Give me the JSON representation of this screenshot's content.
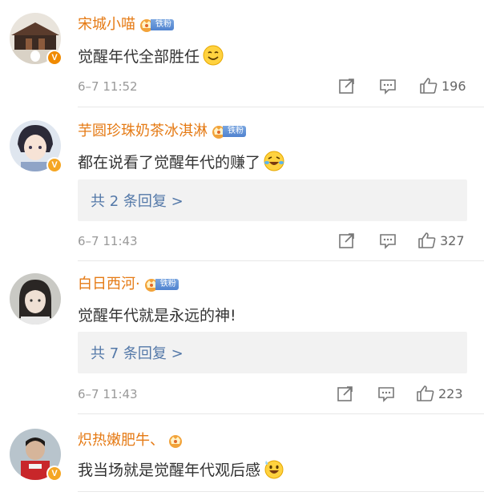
{
  "colors": {
    "username": "#e57a14",
    "reply_link": "#5378a8",
    "timestamp": "#999999",
    "verified_orange": "#f08a00",
    "verified_gold": "#f5a623",
    "fan_tag": "#5b8bd6"
  },
  "comments": [
    {
      "username": "宋城小喵",
      "fan_badge": "铁粉",
      "verified": "V",
      "verified_color": "orange",
      "text": "觉醒年代全部胜任",
      "emoji": "smile-emoji",
      "replies": null,
      "timestamp": "6–7 11:52",
      "likes": "196"
    },
    {
      "username": "芋圆珍珠奶茶冰淇淋",
      "fan_badge": "铁粉",
      "verified": "V",
      "verified_color": "gold",
      "text": "都在说看了觉醒年代的赚了",
      "emoji": "laugh-cry-emoji",
      "replies": "共 2 条回复 >",
      "timestamp": "6–7 11:43",
      "likes": "327"
    },
    {
      "username": "白日西河·",
      "fan_badge": "铁粉",
      "verified": "",
      "text": "觉醒年代就是永远的神!",
      "emoji": "",
      "replies": "共 7 条回复 >",
      "timestamp": "6–7 11:43",
      "likes": "223"
    },
    {
      "username": "炽热嫩肥牛、",
      "fan_badge": "",
      "verified": "V",
      "verified_color": "gold",
      "text": "我当场就是觉醒年代观后感",
      "emoji": "grin-sweat-emoji",
      "replies": null,
      "timestamp": "",
      "likes": ""
    }
  ]
}
